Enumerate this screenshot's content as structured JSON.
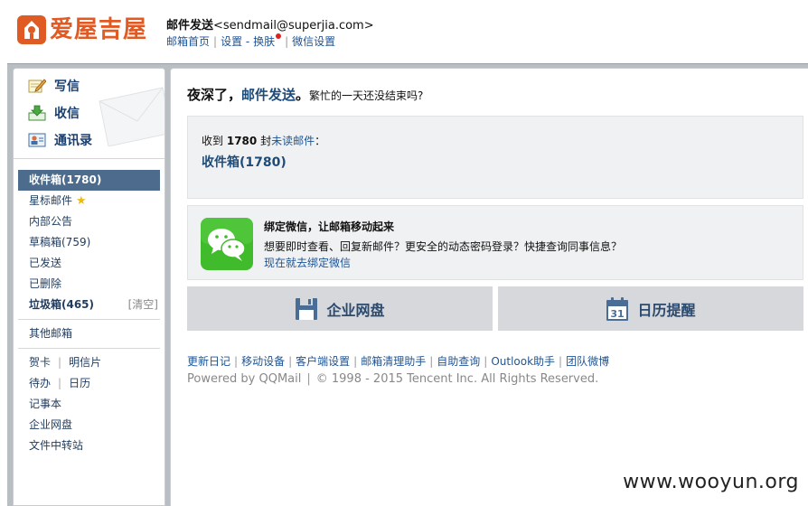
{
  "header": {
    "logo_text": "爱屋吉屋",
    "user_name": "邮件发送",
    "user_email": "<sendmail@superjia.com>",
    "links": {
      "home": "邮箱首页",
      "settings": "设置",
      "dash": "-",
      "skin": "换肤",
      "wechat_settings": "微信设置"
    },
    "separator": "|"
  },
  "quick_actions": {
    "compose": "写信",
    "receive": "收信",
    "contacts": "通讯录"
  },
  "folders": {
    "inbox": "收件箱(1780)",
    "starred": "星标邮件",
    "announcements": "内部公告",
    "drafts": "草稿箱(759)",
    "sent": "已发送",
    "deleted": "已删除",
    "spam": "垃圾箱(465)",
    "spam_clear": "[清空]",
    "other_mailboxes": "其他邮箱",
    "cards": "贺卡",
    "postcards": "明信片",
    "todo": "待办",
    "calendar": "日历",
    "notes": "记事本",
    "enterprise_disk": "企业网盘",
    "file_transfer": "文件中转站",
    "separator": "|"
  },
  "greeting": {
    "prefix": "夜深了，",
    "name": "邮件发送",
    "punct": "。",
    "tail": "繁忙的一天还没结束吗?"
  },
  "mail_summary": {
    "prefix": "收到",
    "count": "1780",
    "unit": "封",
    "unread_link": "未读邮件",
    "colon": "：",
    "inbox_link": "收件箱(1780)"
  },
  "wechat": {
    "title": "绑定微信，让邮箱移动起来",
    "desc": "想要即时查看、回复新邮件？更安全的动态密码登录？快捷查询同事信息？",
    "link": "现在就去绑定微信"
  },
  "tiles": {
    "disk": "企业网盘",
    "calendar": "日历提醒",
    "calendar_day": "31"
  },
  "footer": {
    "links": [
      "更新日记",
      "移动设备",
      "客户端设置",
      "邮箱清理助手",
      "自助查询",
      "Outlook助手",
      "团队微博"
    ],
    "separator": "|",
    "powered": "Powered by QQMail",
    "copyright": "© 1998 - 2015 Tencent Inc. All Rights Reserved."
  },
  "watermark": "www.wooyun.org",
  "colors": {
    "logo": "#e05a24",
    "link": "#1e5494",
    "selected_folder": "#4d6b8c",
    "frame": "#b9bec3",
    "wechat_green": "#3fbb2b"
  },
  "icons": {
    "compose": "pencil-paper-icon",
    "receive": "inbox-arrow-icon",
    "contacts": "contact-card-icon",
    "disk": "floppy-disk-icon",
    "calendar": "calendar-icon",
    "wechat": "wechat-icon",
    "star": "star-icon"
  }
}
